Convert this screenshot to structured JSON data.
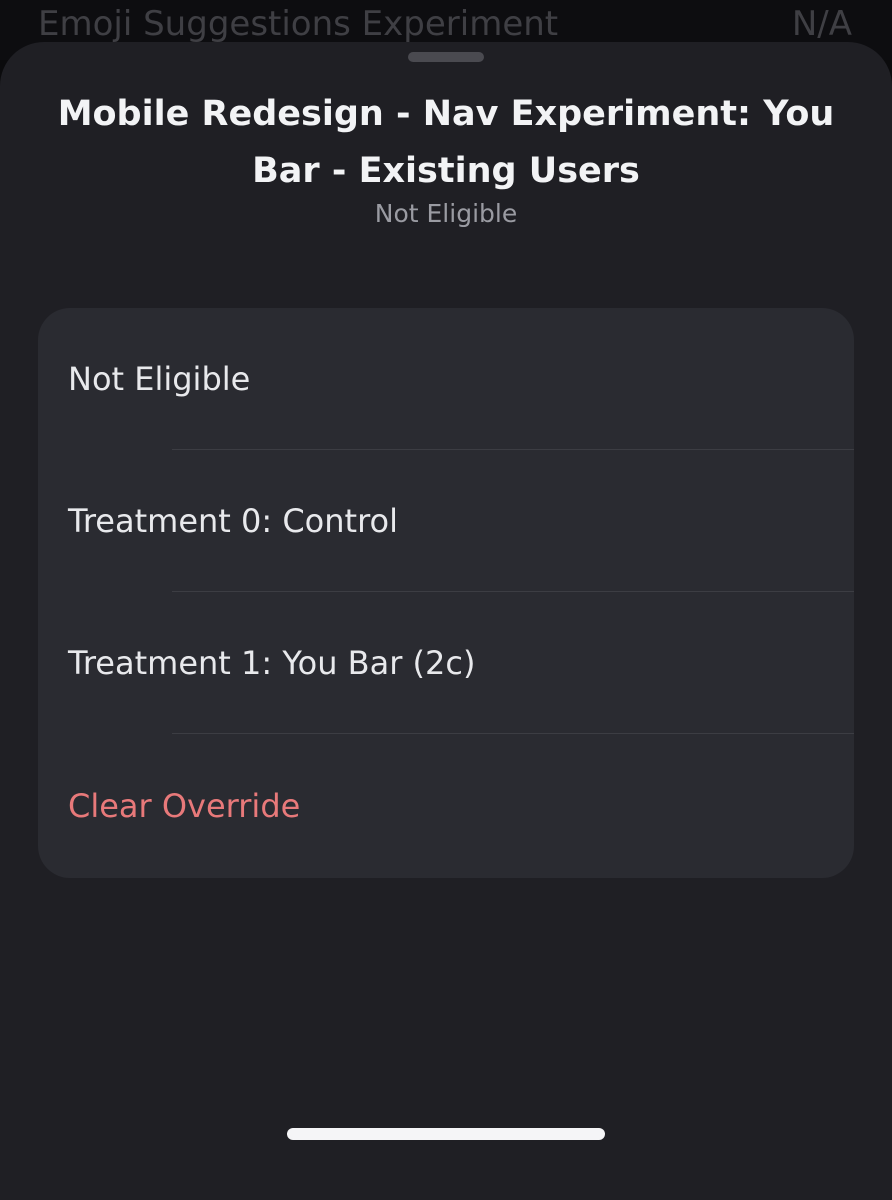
{
  "background": {
    "title": "Emoji Suggestions Experiment",
    "value": "N/A"
  },
  "sheet": {
    "title": "Mobile Redesign - Nav Experiment: You Bar - Existing Users",
    "subtitle": "Not Eligible",
    "options": [
      {
        "label": "Not Eligible"
      },
      {
        "label": "Treatment 0: Control"
      },
      {
        "label": "Treatment 1: You Bar (2c)"
      },
      {
        "label": "Clear Override"
      }
    ]
  },
  "colors": {
    "sheet_background": "#1f1f24",
    "card_background": "#2a2b31",
    "danger": "#e8797a"
  }
}
